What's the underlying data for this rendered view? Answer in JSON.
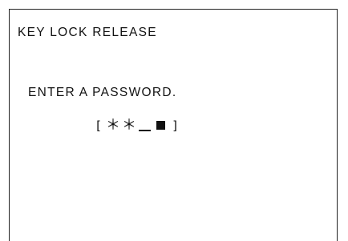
{
  "screen": {
    "title": "KEY LOCK RELEASE",
    "prompt": "ENTER A PASSWORD.",
    "password_field": {
      "open_bracket": "[",
      "close_bracket": "]",
      "entered_chars": [
        "＊",
        "＊"
      ],
      "slots_total": 4,
      "slot_states": [
        "filled",
        "filled",
        "empty",
        "cursor"
      ]
    }
  }
}
